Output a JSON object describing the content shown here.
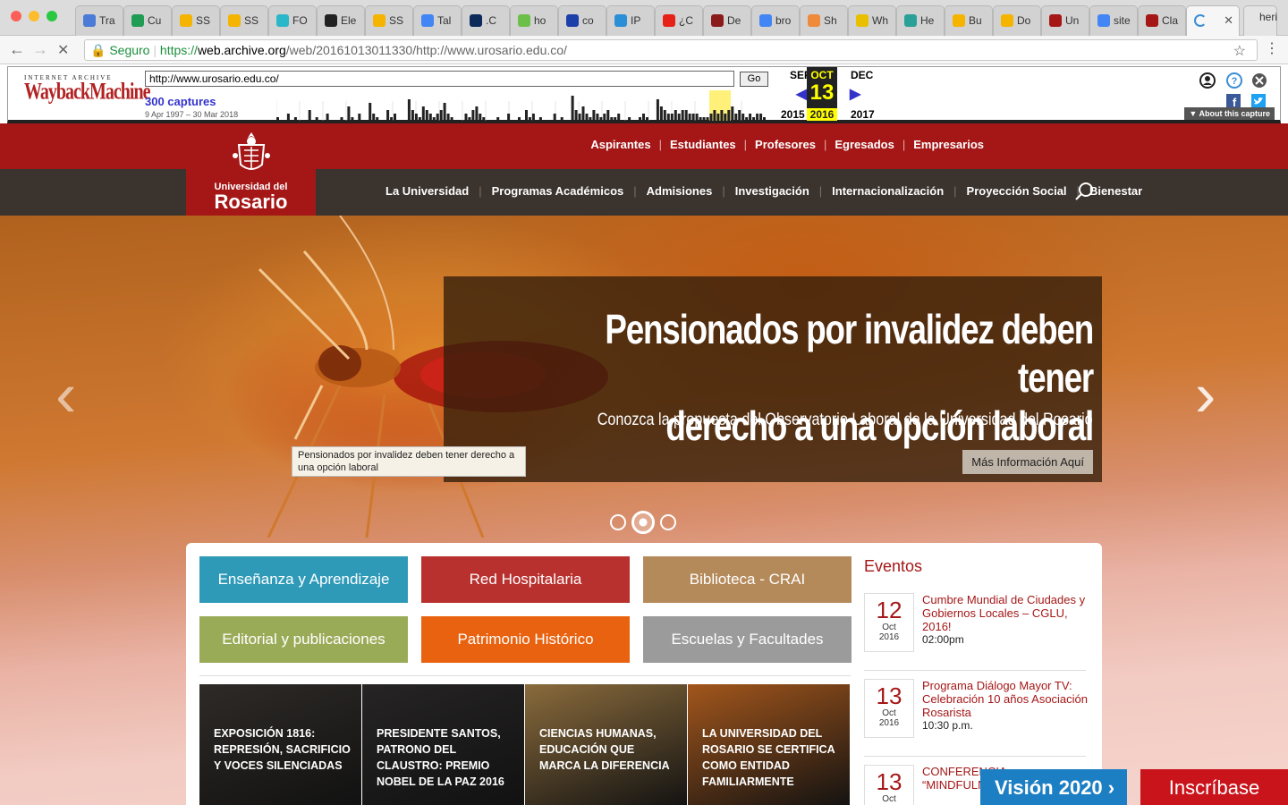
{
  "browser": {
    "tabs": [
      {
        "label": "Tra",
        "color": "#4a7bd6"
      },
      {
        "label": "Cu",
        "color": "#1f9d55"
      },
      {
        "label": "SS",
        "color": "#f4b400"
      },
      {
        "label": "SS",
        "color": "#f4b400"
      },
      {
        "label": "FO",
        "color": "#2ab7c9"
      },
      {
        "label": "Ele",
        "color": "#222222"
      },
      {
        "label": "SS",
        "color": "#f4b400"
      },
      {
        "label": "Tal",
        "color": "#4285f4"
      },
      {
        "label": ".C",
        "color": "#0c2a5a"
      },
      {
        "label": "ho",
        "color": "#6cc04a"
      },
      {
        "label": "co",
        "color": "#1c3faa"
      },
      {
        "label": "IP",
        "color": "#2a8fd6"
      },
      {
        "label": "¿C",
        "color": "#e62117"
      },
      {
        "label": "De",
        "color": "#8b1a1a"
      },
      {
        "label": "bro",
        "color": "#4285f4"
      },
      {
        "label": "Sh",
        "color": "#f08a3b"
      },
      {
        "label": "Wh",
        "color": "#e8c000"
      },
      {
        "label": "He",
        "color": "#2aa198"
      },
      {
        "label": "Bu",
        "color": "#f4b400"
      },
      {
        "label": "Do",
        "color": "#f4b400"
      },
      {
        "label": "Un",
        "color": "#a51717"
      },
      {
        "label": "site",
        "color": "#4285f4"
      },
      {
        "label": "Cla",
        "color": "#a51717"
      }
    ],
    "user": "heri",
    "secure_label": "Seguro",
    "url_scheme": "https://",
    "url_host": "web.archive.org",
    "url_path": "/web/20161013011330/http://www.urosario.edu.co/"
  },
  "wayback": {
    "logo_top": "INTERNET ARCHIVE",
    "logo_main": "WaybackMachine",
    "url_value": "http://www.urosario.edu.co/",
    "go": "Go",
    "captures": "300 captures",
    "range": "9 Apr 1997 – 30 Mar 2018",
    "prev_month": "SEP",
    "cur_month": "OCT",
    "next_month": "DEC",
    "day": "13",
    "prev_year": "2015",
    "cur_year": "2016",
    "next_year": "2017",
    "about": "▼ About this capture",
    "spark": [
      1,
      0,
      0,
      2,
      0,
      1,
      0,
      0,
      0,
      3,
      0,
      1,
      0,
      0,
      2,
      0,
      0,
      0,
      1,
      0,
      4,
      1,
      0,
      2,
      0,
      0,
      5,
      2,
      1,
      0,
      0,
      3,
      1,
      2,
      0,
      0,
      0,
      6,
      3,
      2,
      1,
      4,
      3,
      2,
      1,
      2,
      3,
      5,
      2,
      1,
      0,
      0,
      0,
      2,
      1,
      3,
      4,
      2,
      1,
      0,
      0,
      0,
      1,
      0,
      0,
      2,
      0,
      0,
      1,
      0,
      3,
      1,
      2,
      0,
      1,
      0,
      0,
      0,
      2,
      0,
      1,
      0,
      0,
      7,
      3,
      2,
      4,
      2,
      1,
      3,
      2,
      1,
      2,
      3,
      1,
      1,
      2,
      0,
      0,
      1,
      0,
      0,
      1,
      2,
      1,
      0,
      0,
      6,
      4,
      3,
      2,
      2,
      3,
      2,
      3,
      3,
      2,
      2,
      2,
      1,
      1,
      1,
      2,
      3,
      2,
      3,
      2,
      3,
      4,
      2,
      3,
      2,
      1,
      2,
      1,
      2,
      2,
      1
    ]
  },
  "site": {
    "top_nav": [
      "Aspirantes",
      "Estudiantes",
      "Profesores",
      "Egresados",
      "Empresarios"
    ],
    "main_nav": [
      "La Universidad",
      "Programas Académicos",
      "Admisiones",
      "Investigación",
      "Internacionalización",
      "Proyección Social",
      "Bienestar"
    ],
    "logo_line1": "Universidad del",
    "logo_line2": "Rosario",
    "hero": {
      "title_line1": "Pensionados por invalidez deben tener",
      "title_line2": "derecho a una opción laboral",
      "subtitle": "Conozca la propuesta del Observatorio Laboral de la Universidad del Rosario",
      "button": "Más Información Aquí",
      "tooltip": "Pensionados por invalidez deben tener derecho a una opción laboral",
      "arrow_left": "‹",
      "arrow_right": "›"
    },
    "quick_links": [
      {
        "label": "Enseñanza y Aprendizaje",
        "color": "#2e9ab8"
      },
      {
        "label": "Red Hospitalaria",
        "color": "#b8312f"
      },
      {
        "label": "Biblioteca - CRAI",
        "color": "#b58a5a"
      },
      {
        "label": "Editorial y publicaciones",
        "color": "#9aab58"
      },
      {
        "label": "Patrimonio Histórico",
        "color": "#e8620f"
      },
      {
        "label": "Escuelas y Facultades",
        "color": "#9b9b9b"
      }
    ],
    "news": [
      {
        "title": "Exposición 1816: Represión, sacrificio y voces silenciadas",
        "bg": "#2e2a27"
      },
      {
        "title": "Presidente Santos, patrono del claustro: Premio Nobel de la Paz 2016",
        "bg": "#262424"
      },
      {
        "title": "Ciencias humanas, educación que marca la diferencia",
        "bg": "#8a6b3c"
      },
      {
        "title": "La Universidad del Rosario se certifica como entidad familiarmente",
        "bg": "#a2561c"
      }
    ],
    "events_title": "Eventos",
    "events": [
      {
        "day": "12",
        "month": "Oct",
        "year": "2016",
        "title": "Cumbre Mundial de Ciudades y Gobiernos Locales – CGLU, 2016!",
        "time": "02:00pm"
      },
      {
        "day": "13",
        "month": "Oct",
        "year": "2016",
        "title": "Programa Diálogo Mayor TV: Celebración 10 años Asociación Rosarista",
        "time": "10:30 p.m."
      },
      {
        "day": "13",
        "month": "Oct",
        "year": "",
        "title": "CONFERENCIA “MINDFULNESS CEREBRO",
        "time": ""
      }
    ],
    "vision": "Visión 2020",
    "vision_arrow": "›",
    "inscribase": "Inscríbase"
  }
}
